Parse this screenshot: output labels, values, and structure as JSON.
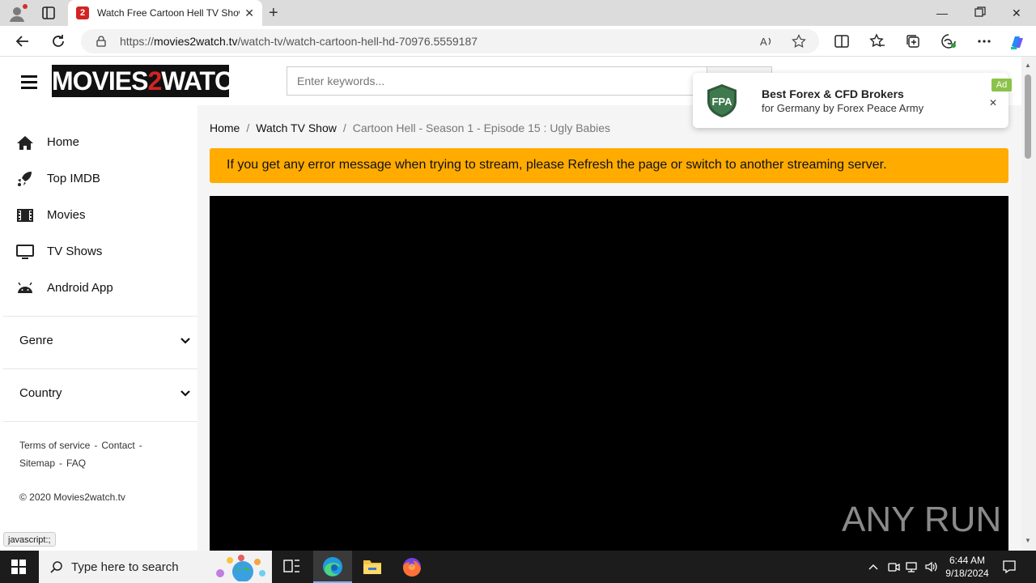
{
  "browser": {
    "tab_title": "Watch Free Cartoon Hell TV Shows Online",
    "tab_favicon": "2",
    "url_prefix": "https://",
    "url_domain": "movies2watch.tv",
    "url_path": "/watch-tv/watch-cartoon-hell-hd-70976.5559187"
  },
  "site": {
    "logo_left": "MOVIES",
    "logo_mid": "2",
    "logo_right": "WATCH",
    "search_placeholder": "Enter keywords..."
  },
  "sidebar": {
    "items": [
      {
        "label": "Home",
        "icon": "home-icon"
      },
      {
        "label": "Top IMDB",
        "icon": "rocket-icon"
      },
      {
        "label": "Movies",
        "icon": "film-icon"
      },
      {
        "label": "TV Shows",
        "icon": "tv-icon"
      },
      {
        "label": "Android App",
        "icon": "android-icon"
      }
    ],
    "genre_label": "Genre",
    "country_label": "Country",
    "footer": {
      "terms": "Terms of service",
      "contact": "Contact",
      "sitemap": "Sitemap",
      "faq": "FAQ",
      "sep": "-",
      "copyright": "© 2020 Movies2watch.tv"
    }
  },
  "content": {
    "breadcrumb": {
      "home": "Home",
      "section": "Watch TV Show",
      "current": "Cartoon Hell - Season 1 - Episode 15 : Ugly Babies",
      "sep": "/"
    },
    "alert": "If you get any error message when trying to stream, please Refresh the page or switch to another streaming server."
  },
  "ad": {
    "logo_text": "FPA",
    "title": "Best Forex & CFD Brokers",
    "subtitle": "for Germany by Forex Peace Army",
    "badge": "Ad",
    "close": "✕"
  },
  "status_tooltip": "javascript:;",
  "watermark": "ANY RUN",
  "taskbar": {
    "search_placeholder": "Type here to search",
    "time": "6:44 AM",
    "date": "9/18/2024"
  },
  "colors": {
    "alert_bg": "#ffab00",
    "logo_red": "#d32323",
    "content_bg": "#f5f5f5"
  }
}
